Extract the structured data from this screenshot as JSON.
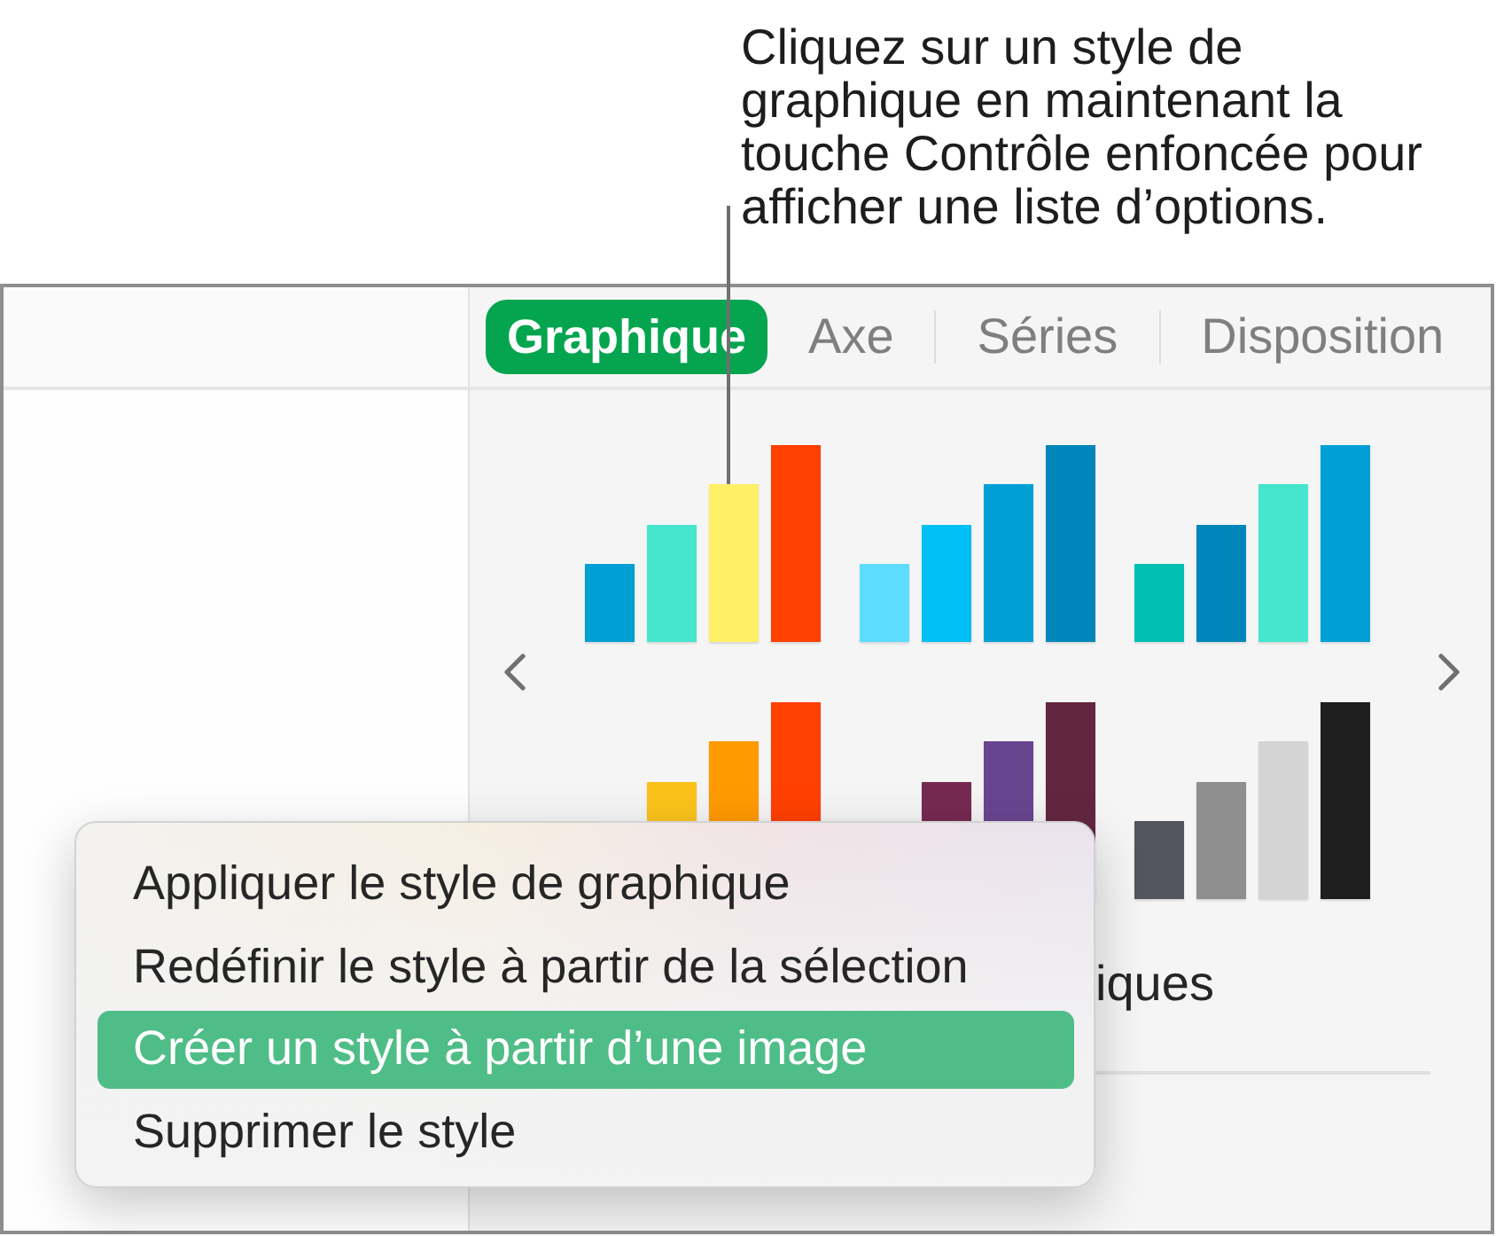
{
  "callout": {
    "text": "Cliquez sur un style de\ngraphique en maintenant la\ntouche Contrôle enfoncée pour\nafficher une liste d’options."
  },
  "tabs": [
    {
      "label": "Graphique",
      "selected": true
    },
    {
      "label": "Axe",
      "selected": false
    },
    {
      "label": "Séries",
      "selected": false
    },
    {
      "label": "Disposition",
      "selected": false
    }
  ],
  "style_presets": [
    {
      "bars": [
        {
          "color": "#009fd4"
        },
        {
          "color": "#45e6cd"
        },
        {
          "color": "#fff067"
        },
        {
          "color": "#ff4000"
        }
      ]
    },
    {
      "bars": [
        {
          "color": "#5ddcff"
        },
        {
          "color": "#00bff4"
        },
        {
          "color": "#00a0d6"
        },
        {
          "color": "#0086b9"
        }
      ]
    },
    {
      "bars": [
        {
          "color": "#00c0b4"
        },
        {
          "color": "#0086b9"
        },
        {
          "color": "#45e6cd"
        },
        {
          "color": "#00a0d6"
        }
      ]
    },
    {
      "bars": [
        {
          "color": "#fbc31a"
        },
        {
          "color": "#ff9a00"
        },
        {
          "color": "#ff4000"
        }
      ]
    },
    {
      "bars": [
        {
          "color": "#762a52"
        },
        {
          "color": "#694590"
        },
        {
          "color": "#62273f"
        }
      ]
    },
    {
      "bars": [
        {
          "color": "#53565e"
        },
        {
          "color": "#8f8f8f"
        },
        {
          "color": "#d4d4d4"
        },
        {
          "color": "#1e1e1e"
        }
      ]
    }
  ],
  "section_label": "iques",
  "context_menu": {
    "items": [
      {
        "label": "Appliquer le style de graphique",
        "selected": false
      },
      {
        "label": "Redéfinir le style à partir de la sélection",
        "selected": false
      },
      {
        "label": "Créer un style à partir d’une image",
        "selected": true
      },
      {
        "label": "Supprimer le style",
        "selected": false
      }
    ]
  }
}
